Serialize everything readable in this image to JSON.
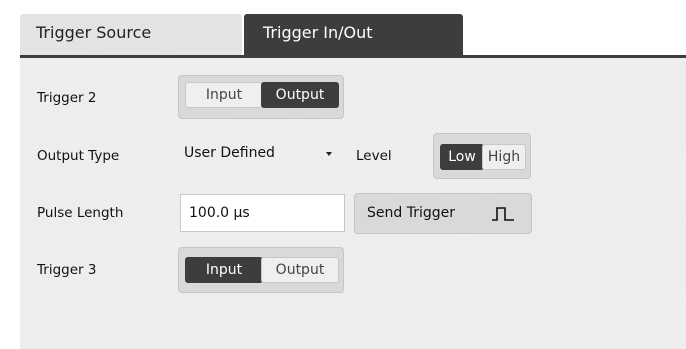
{
  "tabs": [
    {
      "label": "Trigger Source",
      "active": false
    },
    {
      "label": "Trigger In/Out",
      "active": true
    }
  ],
  "trigger2": {
    "label": "Trigger 2",
    "options": [
      "Input",
      "Output"
    ],
    "selected": "Output"
  },
  "output_type": {
    "label": "Output Type",
    "value": "User Defined"
  },
  "level": {
    "label": "Level",
    "options": [
      "Low",
      "High"
    ],
    "selected": "Low"
  },
  "pulse_length": {
    "label": "Pulse Length",
    "value": "100.0 µs"
  },
  "send_trigger": {
    "label": "Send Trigger",
    "icon": "pulse-icon"
  },
  "trigger3": {
    "label": "Trigger 3",
    "options": [
      "Input",
      "Output"
    ],
    "selected": "Input"
  },
  "colors": {
    "active": "#3d3d3d",
    "panel": "#f0f0f0",
    "button": "#d9d9d9"
  }
}
